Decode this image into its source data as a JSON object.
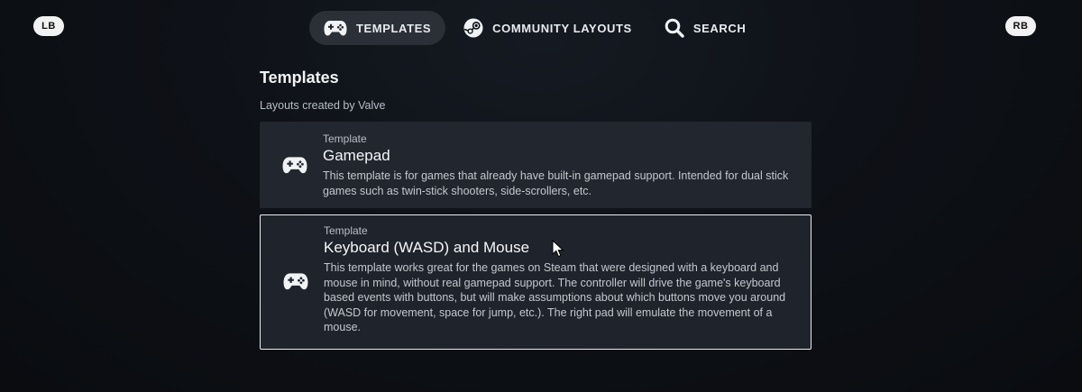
{
  "shoulders": {
    "left": "LB",
    "right": "RB"
  },
  "tabs": [
    {
      "label": "TEMPLATES",
      "icon": "gamepad-icon",
      "active": true
    },
    {
      "label": "COMMUNITY LAYOUTS",
      "icon": "steam-icon",
      "active": false
    },
    {
      "label": "SEARCH",
      "icon": "search-icon",
      "active": false
    }
  ],
  "main": {
    "title": "Templates",
    "subtitle": "Layouts created by Valve",
    "templates": [
      {
        "kicker": "Template",
        "title": "Gamepad",
        "icon": "gamepad-icon",
        "selected": false,
        "description": "This template is for games that already have built-in gamepad support. Intended for dual stick games such as twin-stick shooters, side-scrollers, etc."
      },
      {
        "kicker": "Template",
        "title": "Keyboard (WASD) and Mouse",
        "icon": "gamepad-icon",
        "selected": true,
        "description": "This template works great for the games on Steam that were designed with a keyboard and mouse in mind, without real gamepad support. The controller will drive the game's keyboard based events with buttons, but will make assumptions about which buttons move you around (WASD for movement, space for jump, etc.). The right pad will emulate the movement of a mouse."
      }
    ]
  },
  "colors": {
    "background": "#0b0d12",
    "active_tab": "#2a2f38",
    "card": "#22262e",
    "selected_border": "#e9ecef"
  }
}
